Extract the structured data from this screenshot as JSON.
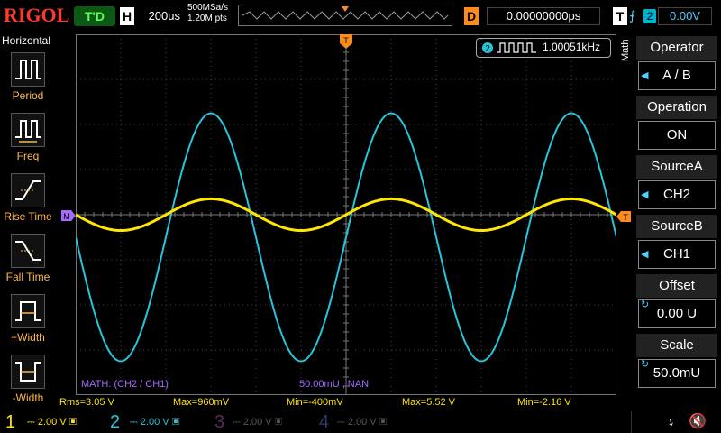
{
  "header": {
    "logo": "RIGOL",
    "run_state": "T'D",
    "h_badge": "H",
    "timebase": "200us",
    "sample_rate": "500MSa/s",
    "mem_depth": "1.20M pts",
    "d_badge": "D",
    "delay": "0.00000000ps",
    "t_badge": "T",
    "trigger_source": "2",
    "trigger_level": "0.00V"
  },
  "left_panel": {
    "title": "Horizontal",
    "items": [
      {
        "label": "Period"
      },
      {
        "label": "Freq"
      },
      {
        "label": "Rise Time"
      },
      {
        "label": "Fall Time"
      },
      {
        "label": "+Width"
      },
      {
        "label": "-Width"
      }
    ]
  },
  "right_panel": {
    "side_label": "Math",
    "sections": [
      {
        "title": "Operator",
        "value": "A / B"
      },
      {
        "title": "Operation",
        "value": "ON"
      },
      {
        "title": "SourceA",
        "value": "CH2"
      },
      {
        "title": "SourceB",
        "value": "CH1"
      },
      {
        "title": "Offset",
        "value": "0.00 U"
      },
      {
        "title": "Scale",
        "value": "50.0mU"
      }
    ]
  },
  "freq_counter": {
    "channel": "2",
    "value": "1.00051kHz"
  },
  "screen": {
    "math_label": "MATH: (CH2 / CH1)",
    "math_scale": "50.00mU , NAN",
    "trigger_marker": "T",
    "math_marker": "M"
  },
  "measurements": [
    {
      "text": "Rms=3.05 V"
    },
    {
      "text": "Max=960mV"
    },
    {
      "text": "Min=-400mV"
    },
    {
      "text": "Max=5.52 V"
    },
    {
      "text": "Min=-2.16 V"
    }
  ],
  "channels": [
    {
      "num": "1",
      "scale": "2.00 V",
      "color": "#ffe600"
    },
    {
      "num": "2",
      "scale": "2.00 V",
      "color": "#26c6da"
    },
    {
      "num": "3",
      "scale": "2.00 V",
      "color": "#c040c0"
    },
    {
      "num": "4",
      "scale": "2.00 V",
      "color": "#3060ff"
    }
  ],
  "colors": {
    "ch1": "#ffe600",
    "ch2": "#26c6da",
    "math": "#a46bff",
    "accent_orange": "#ff8c1a",
    "grid": "#4a4a4a"
  },
  "waveforms": {
    "ch1": {
      "amplitude_div": 0.35,
      "center_div": 0.0,
      "period_div": 4.0,
      "phase_div": 0.0
    },
    "ch2": {
      "amplitude_div": 2.75,
      "center_div": 0.5,
      "period_div": 4.0,
      "phase_div": 0.0,
      "clip_high_div": 2.8
    }
  }
}
